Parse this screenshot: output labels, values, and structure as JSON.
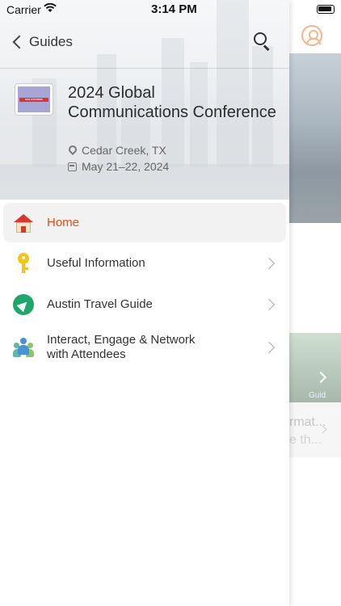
{
  "status_bar": {
    "carrier": "Carrier",
    "time": "3:14 PM"
  },
  "nav": {
    "back_label": "Guides"
  },
  "event": {
    "title": "2024 Global Communications Conference",
    "location": "Cedar Creek, TX",
    "dates": "May 21–22, 2024",
    "logo_text": "BAE SYSTEMS"
  },
  "menu": {
    "items": [
      {
        "label": "Home",
        "icon": "house-icon",
        "active": true
      },
      {
        "label": "Useful Information",
        "icon": "key-icon"
      },
      {
        "label": "Austin Travel Guide",
        "icon": "navigation-arrow-icon"
      },
      {
        "label": "Interact, Engage & Network with Attendees",
        "icon": "people-group-icon"
      }
    ]
  },
  "background": {
    "text_line1": "rmat...",
    "text_line2": "e th...",
    "card_small": "Guid"
  },
  "colors": {
    "accent": "#e24e12",
    "profile": "#f6b58a"
  }
}
